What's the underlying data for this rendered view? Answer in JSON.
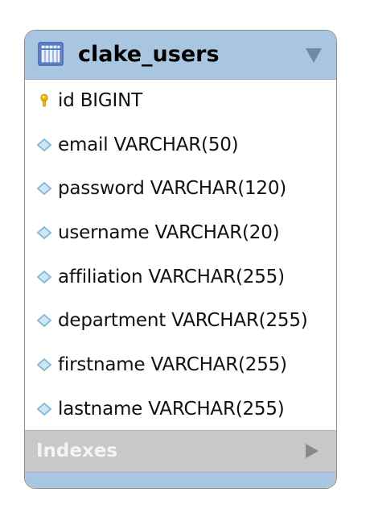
{
  "table": {
    "name": "clake_users",
    "icon": "table-icon",
    "collapse_icon": "collapse-arrow-icon",
    "columns": [
      {
        "text": "id BIGINT",
        "icon": "primary-key-icon"
      },
      {
        "text": "email VARCHAR(50)",
        "icon": "column-diamond-icon"
      },
      {
        "text": "password VARCHAR(120)",
        "icon": "column-diamond-icon"
      },
      {
        "text": "username VARCHAR(20)",
        "icon": "column-diamond-icon"
      },
      {
        "text": "affiliation VARCHAR(255)",
        "icon": "column-diamond-icon"
      },
      {
        "text": "department VARCHAR(255)",
        "icon": "column-diamond-icon"
      },
      {
        "text": "firstname VARCHAR(255)",
        "icon": "column-diamond-icon"
      },
      {
        "text": "lastname VARCHAR(255)",
        "icon": "column-diamond-icon"
      }
    ]
  },
  "indexes": {
    "label": "Indexes",
    "expand_icon": "expand-arrow-icon"
  },
  "colors": {
    "header": "#a9c6e0",
    "indexes_bar": "#c8c8c8",
    "key": "#f2b705",
    "diamond": "#7fb8d8"
  }
}
